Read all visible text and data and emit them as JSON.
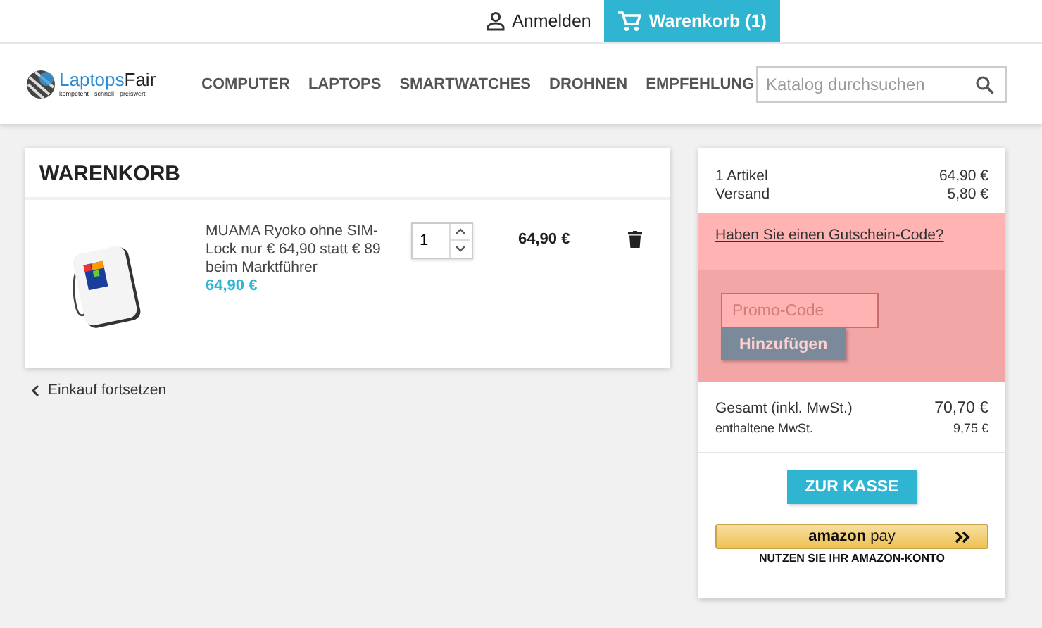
{
  "top_bar": {
    "login": "Anmelden",
    "cart": "Warenkorb (1)"
  },
  "logo": {
    "brand_a": "Laptops",
    "brand_b": "Fair",
    "tagline": "kompetent - schnell - preiswert"
  },
  "nav": [
    {
      "label": "COMPUTER"
    },
    {
      "label": "LAPTOPS"
    },
    {
      "label": "SMARTWATCHES"
    },
    {
      "label": "DROHNEN"
    },
    {
      "label": "EMPFEHLUNG"
    }
  ],
  "search": {
    "placeholder": "Katalog durchsuchen"
  },
  "cart": {
    "title": "WARENKORB",
    "items": [
      {
        "kind": "picture",
        "name": "MUAMA Ryoko ohne SIM-Lock nur € 64,90 statt € 89 beim Marktführer",
        "unit_price": "64,90 €",
        "quantity": "1",
        "total": "64,90 €"
      }
    ],
    "continue": "Einkauf fortsetzen"
  },
  "summary": {
    "lines": [
      {
        "label": "1 Artikel",
        "value": "64,90 €"
      },
      {
        "label": "Versand",
        "value": "5,80 €"
      }
    ],
    "voucher_link": "Haben Sie einen Gutschein-Code?",
    "promo_placeholder": "Promo-Code",
    "promo_button": "Hinzufügen",
    "total": {
      "label": "Gesamt (inkl. MwSt.)",
      "value": "70,70 €"
    },
    "tax": {
      "label": "enthaltene MwSt.",
      "value": "9,75 €"
    },
    "checkout": "ZUR KASSE",
    "amazon_a": "amazon",
    "amazon_b": "pay",
    "amazon_caption": "NUTZEN SIE IHR AMAZON-KONTO"
  }
}
